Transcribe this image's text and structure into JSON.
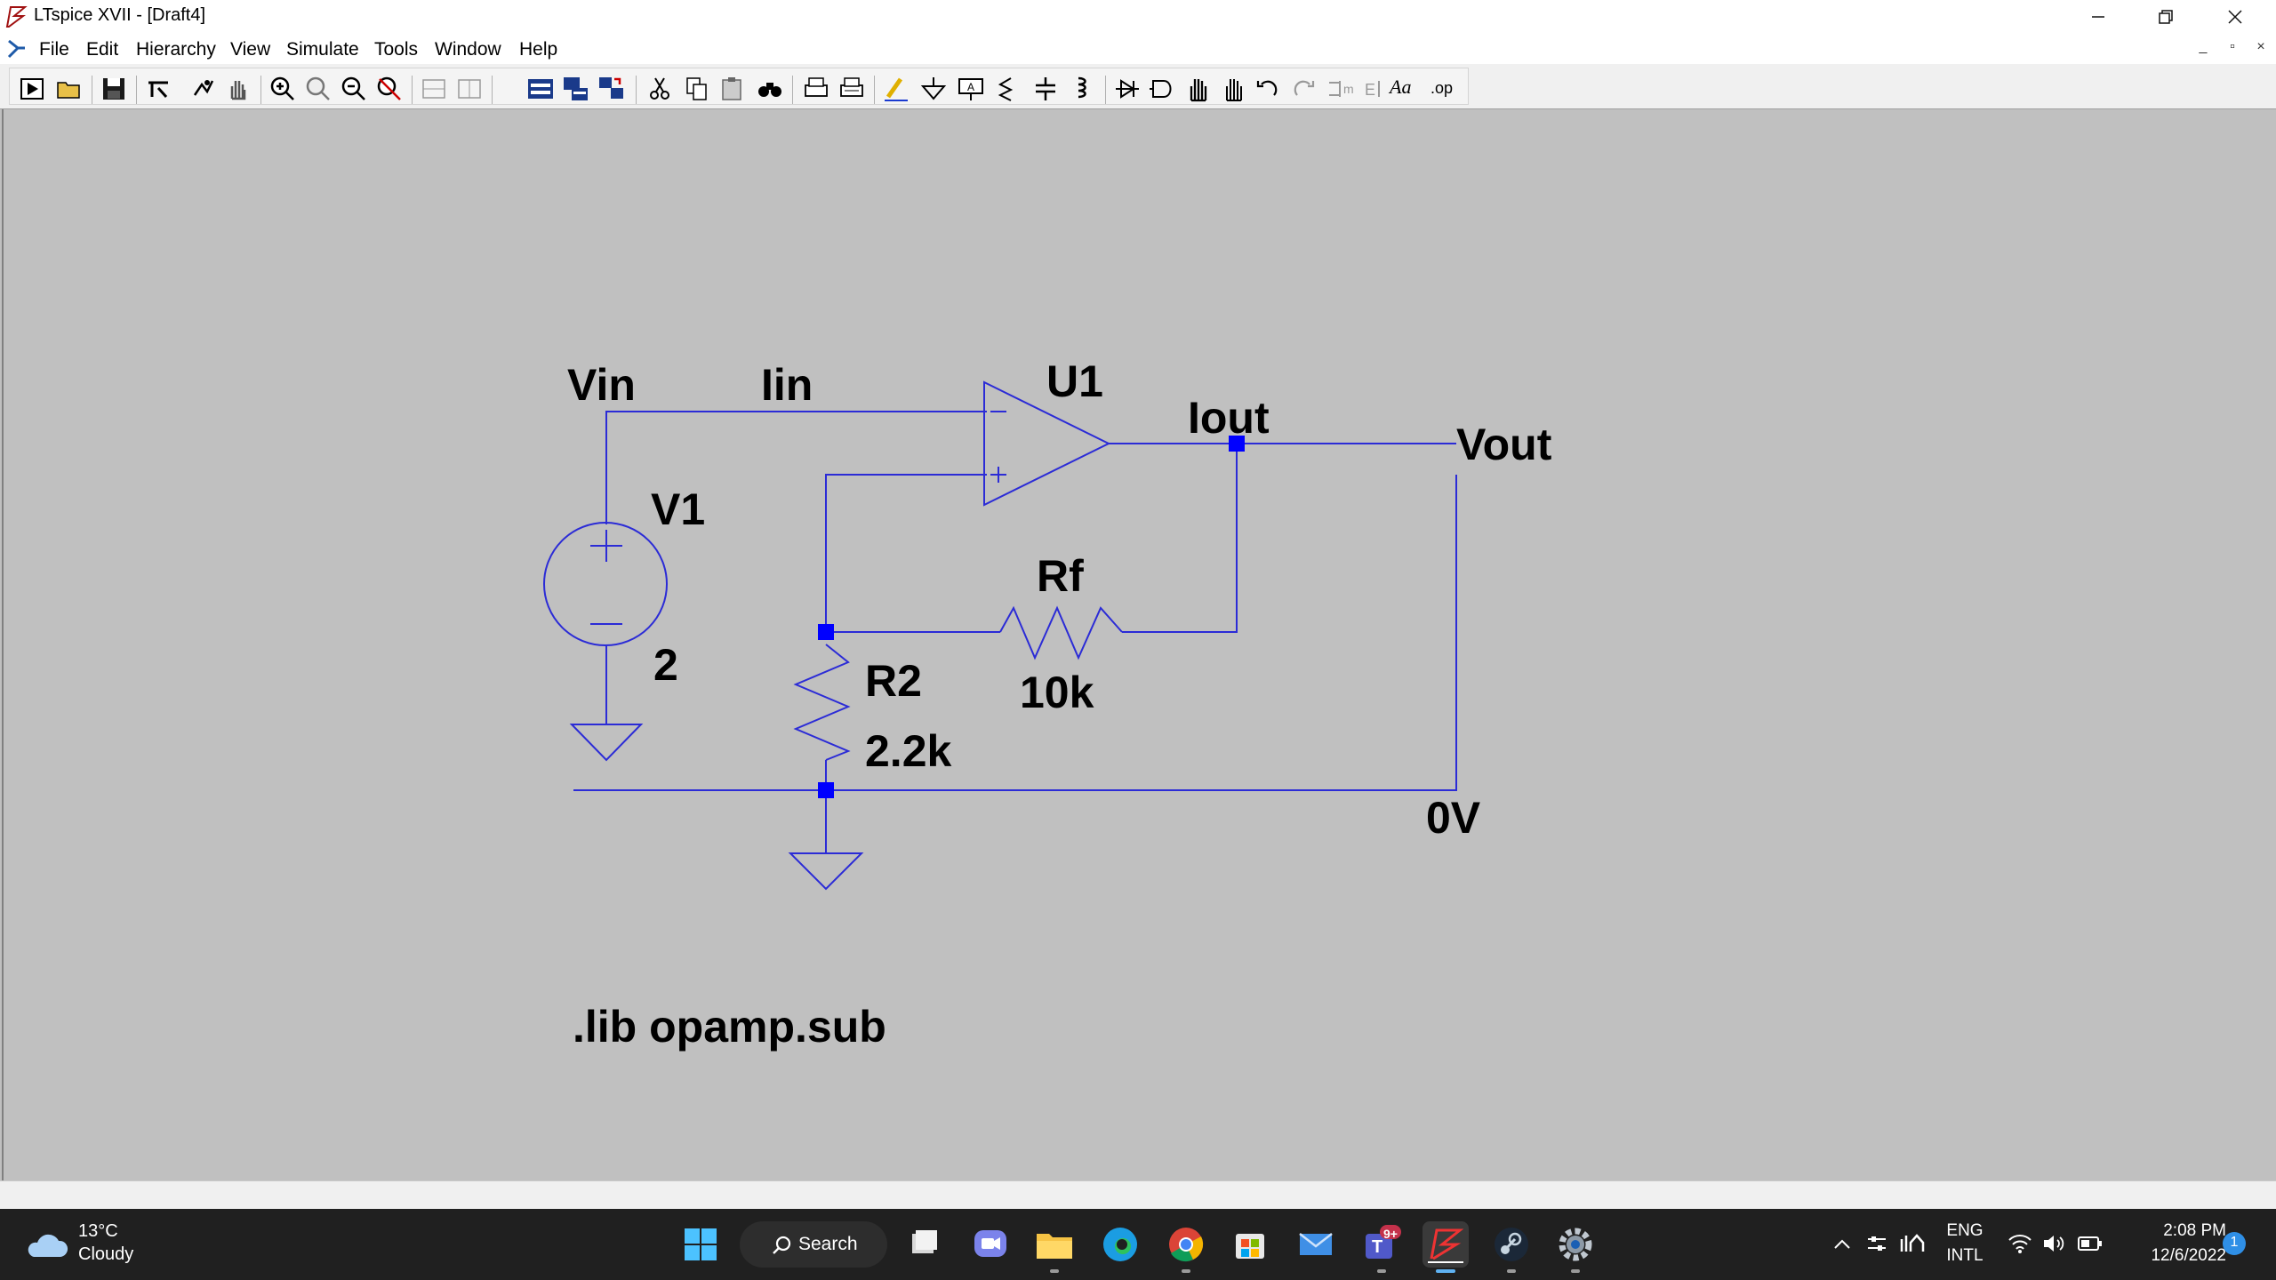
{
  "window": {
    "title": "LTspice XVII - [Draft4]",
    "controls": [
      "minimize",
      "restore",
      "close"
    ]
  },
  "menu": {
    "items": [
      {
        "label": "File"
      },
      {
        "label": "Edit"
      },
      {
        "label": "Hierarchy"
      },
      {
        "label": "View"
      },
      {
        "label": "Simulate"
      },
      {
        "label": "Tools"
      },
      {
        "label": "Window"
      },
      {
        "label": "Help"
      }
    ],
    "mdi_controls": [
      "_",
      "▫",
      "×"
    ]
  },
  "toolbar": {
    "buttons": [
      "run-icon",
      "open-icon",
      "save-icon",
      "control-panel-icon",
      "halt-icon",
      "pan-icon",
      "zoom-in-icon",
      "zoom-back-icon",
      "zoom-out-icon",
      "zoom-full-icon",
      "tile-horizontal-icon",
      "tile-vertical-icon",
      "cascade-icon",
      "close-all-icon",
      "arrange-icon",
      "cut-icon",
      "copy-icon",
      "paste-icon",
      "find-icon",
      "print-icon",
      "print-setup-icon",
      "wire-icon",
      "ground-icon",
      "label-net-icon",
      "resistor-icon",
      "capacitor-icon",
      "inductor-icon",
      "diode-icon",
      "component-icon",
      "move-icon",
      "drag-icon",
      "undo-icon",
      "redo-icon",
      "rotate-icon",
      "mirror-icon",
      "text-icon",
      "spice-directive-icon"
    ],
    "text_button": "Aa",
    "op_button": ".op"
  },
  "schematic": {
    "wire_color": "#2b2bd6",
    "junction_color": "#0000ff",
    "labels": {
      "vin": "Vin",
      "iin": "Iin",
      "u1": "U1",
      "iout": "Iout",
      "vout": "Vout",
      "v1": "V1",
      "v1_value": "2",
      "rf": "Rf",
      "rf_value": "10k",
      "r2": "R2",
      "r2_value": "2.2k",
      "zero_v": "0V",
      "directive": ".lib opamp.sub"
    }
  },
  "taskbar": {
    "weather": {
      "temp": "13°C",
      "condition": "Cloudy"
    },
    "search_label": "Search",
    "teams_badge": "9+",
    "language": "ENG",
    "layout": "INTL",
    "time": "2:08 PM",
    "date": "12/6/2022",
    "notification_count": "1"
  }
}
